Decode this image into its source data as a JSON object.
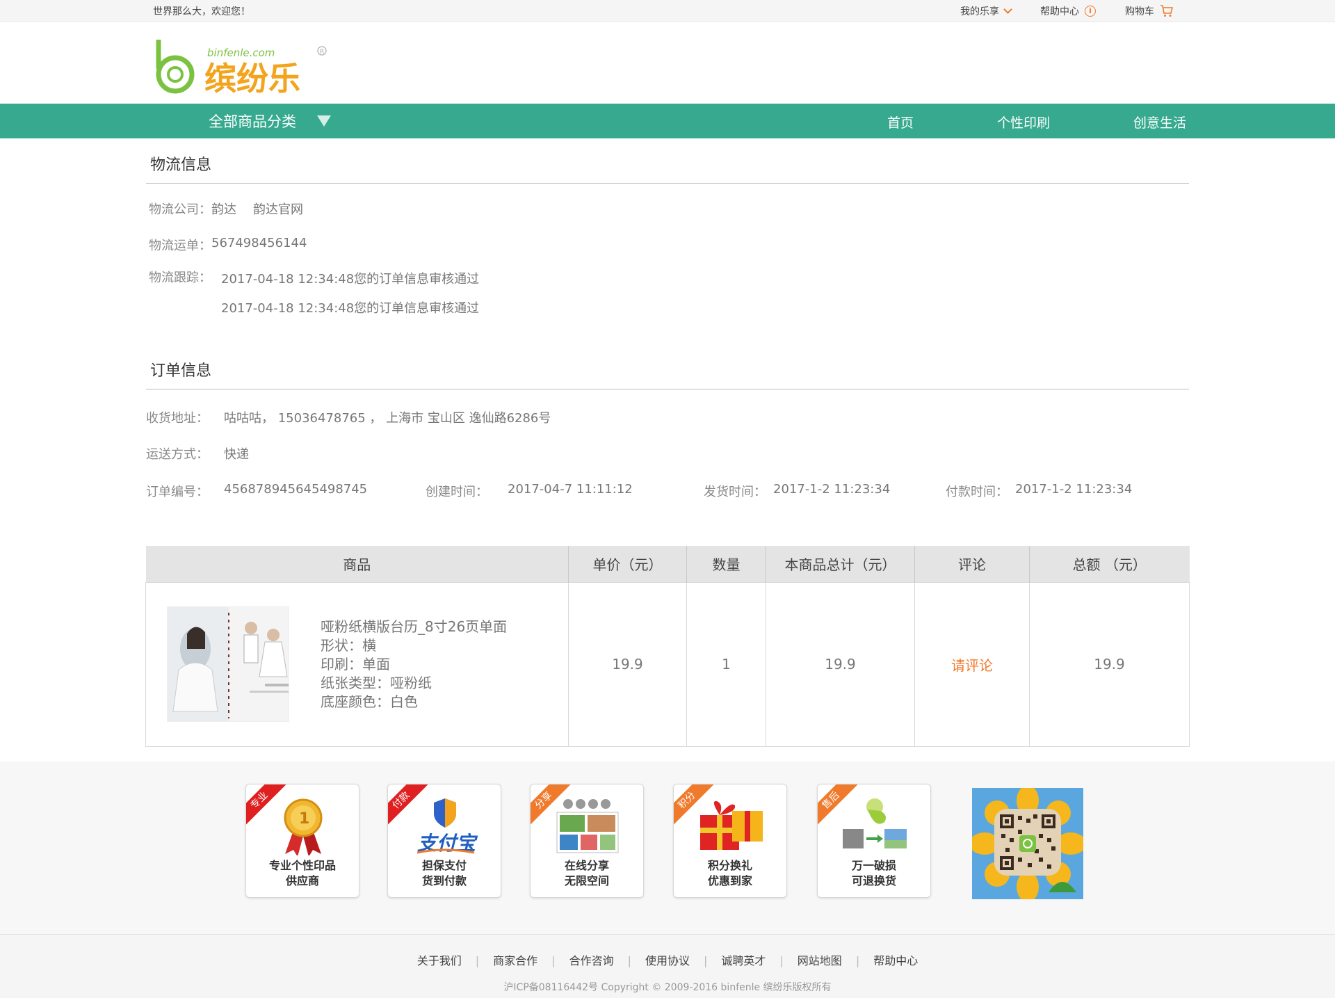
{
  "topbar": {
    "welcome": "世界那么大，欢迎您！",
    "my_lexiang": "我的乐享",
    "help_center": "帮助中心",
    "cart": "购物车"
  },
  "logo": {
    "domain": "binfenle.com",
    "brand": "缤纷乐"
  },
  "nav": {
    "category_label": "全部商品分类",
    "links": [
      "首页",
      "个性印刷",
      "创意生活"
    ]
  },
  "logistics": {
    "title": "物流信息",
    "company_label": "物流公司：",
    "company": "韵达",
    "company_site": "韵达官网",
    "waybill_label": "物流运单：",
    "waybill": "567498456144",
    "tracking_label": "物流跟踪：",
    "tracking": [
      "2017-04-18 12:34:48您的订单信息审核通过",
      "2017-04-18 12:34:48您的订单信息审核通过"
    ]
  },
  "order": {
    "title": "订单信息",
    "address_label": "收货地址：",
    "address": "咕咕咕， 15036478765 ， 上海市 宝山区 逸仙路6286号",
    "shipping_label": "运送方式：",
    "shipping": "快递",
    "number_label": "订单编号：",
    "number": "456878945645498745",
    "created_label": "创建时间：",
    "created": "2017-04-7  11:11:12",
    "shipped_label": "发货时间：",
    "shipped": "2017-1-2 11:23:34",
    "paid_label": "付款时间：",
    "paid": "2017-1-2 11:23:34"
  },
  "table": {
    "headers": [
      "商品",
      "单价（元）",
      "数量",
      "本商品总计（元）",
      "评论",
      "总额  （元）"
    ],
    "row": {
      "name": "哑粉纸横版台历_8寸26页单面",
      "specs": [
        "形状：横",
        "印刷：单面",
        "纸张类型：哑粉纸",
        "底座颜色：白色"
      ],
      "price": "19.9",
      "qty": "1",
      "subtotal": "19.9",
      "comment": "请评论",
      "total": "19.9"
    }
  },
  "badges": [
    {
      "ribbon": "专业",
      "line1": "专业个性印品",
      "line2": "供应商",
      "icon": "medal-icon",
      "color": "#e02020"
    },
    {
      "ribbon": "付款",
      "line1": "担保支付",
      "line2": "货到付款",
      "icon": "alipay-icon",
      "color": "#e02020"
    },
    {
      "ribbon": "分享",
      "line1": "在线分享",
      "line2": "无限空间",
      "icon": "share-photos-icon",
      "color": "#f07a2c"
    },
    {
      "ribbon": "积分",
      "line1": "积分换礼",
      "line2": "优惠到家",
      "icon": "gift-icon",
      "color": "#f07a2c"
    },
    {
      "ribbon": "售后",
      "line1": "万一破损",
      "line2": "可退换货",
      "icon": "exchange-icon",
      "color": "#f07a2c"
    }
  ],
  "footer": {
    "links": [
      "关于我们",
      "商家合作",
      "合作咨询",
      "使用协议",
      "诚聘英才",
      "网站地图",
      "帮助中心"
    ],
    "copyright": "沪ICP备08116442号 Copyright © 2009-2016 binfenle 缤纷乐版权所有"
  }
}
